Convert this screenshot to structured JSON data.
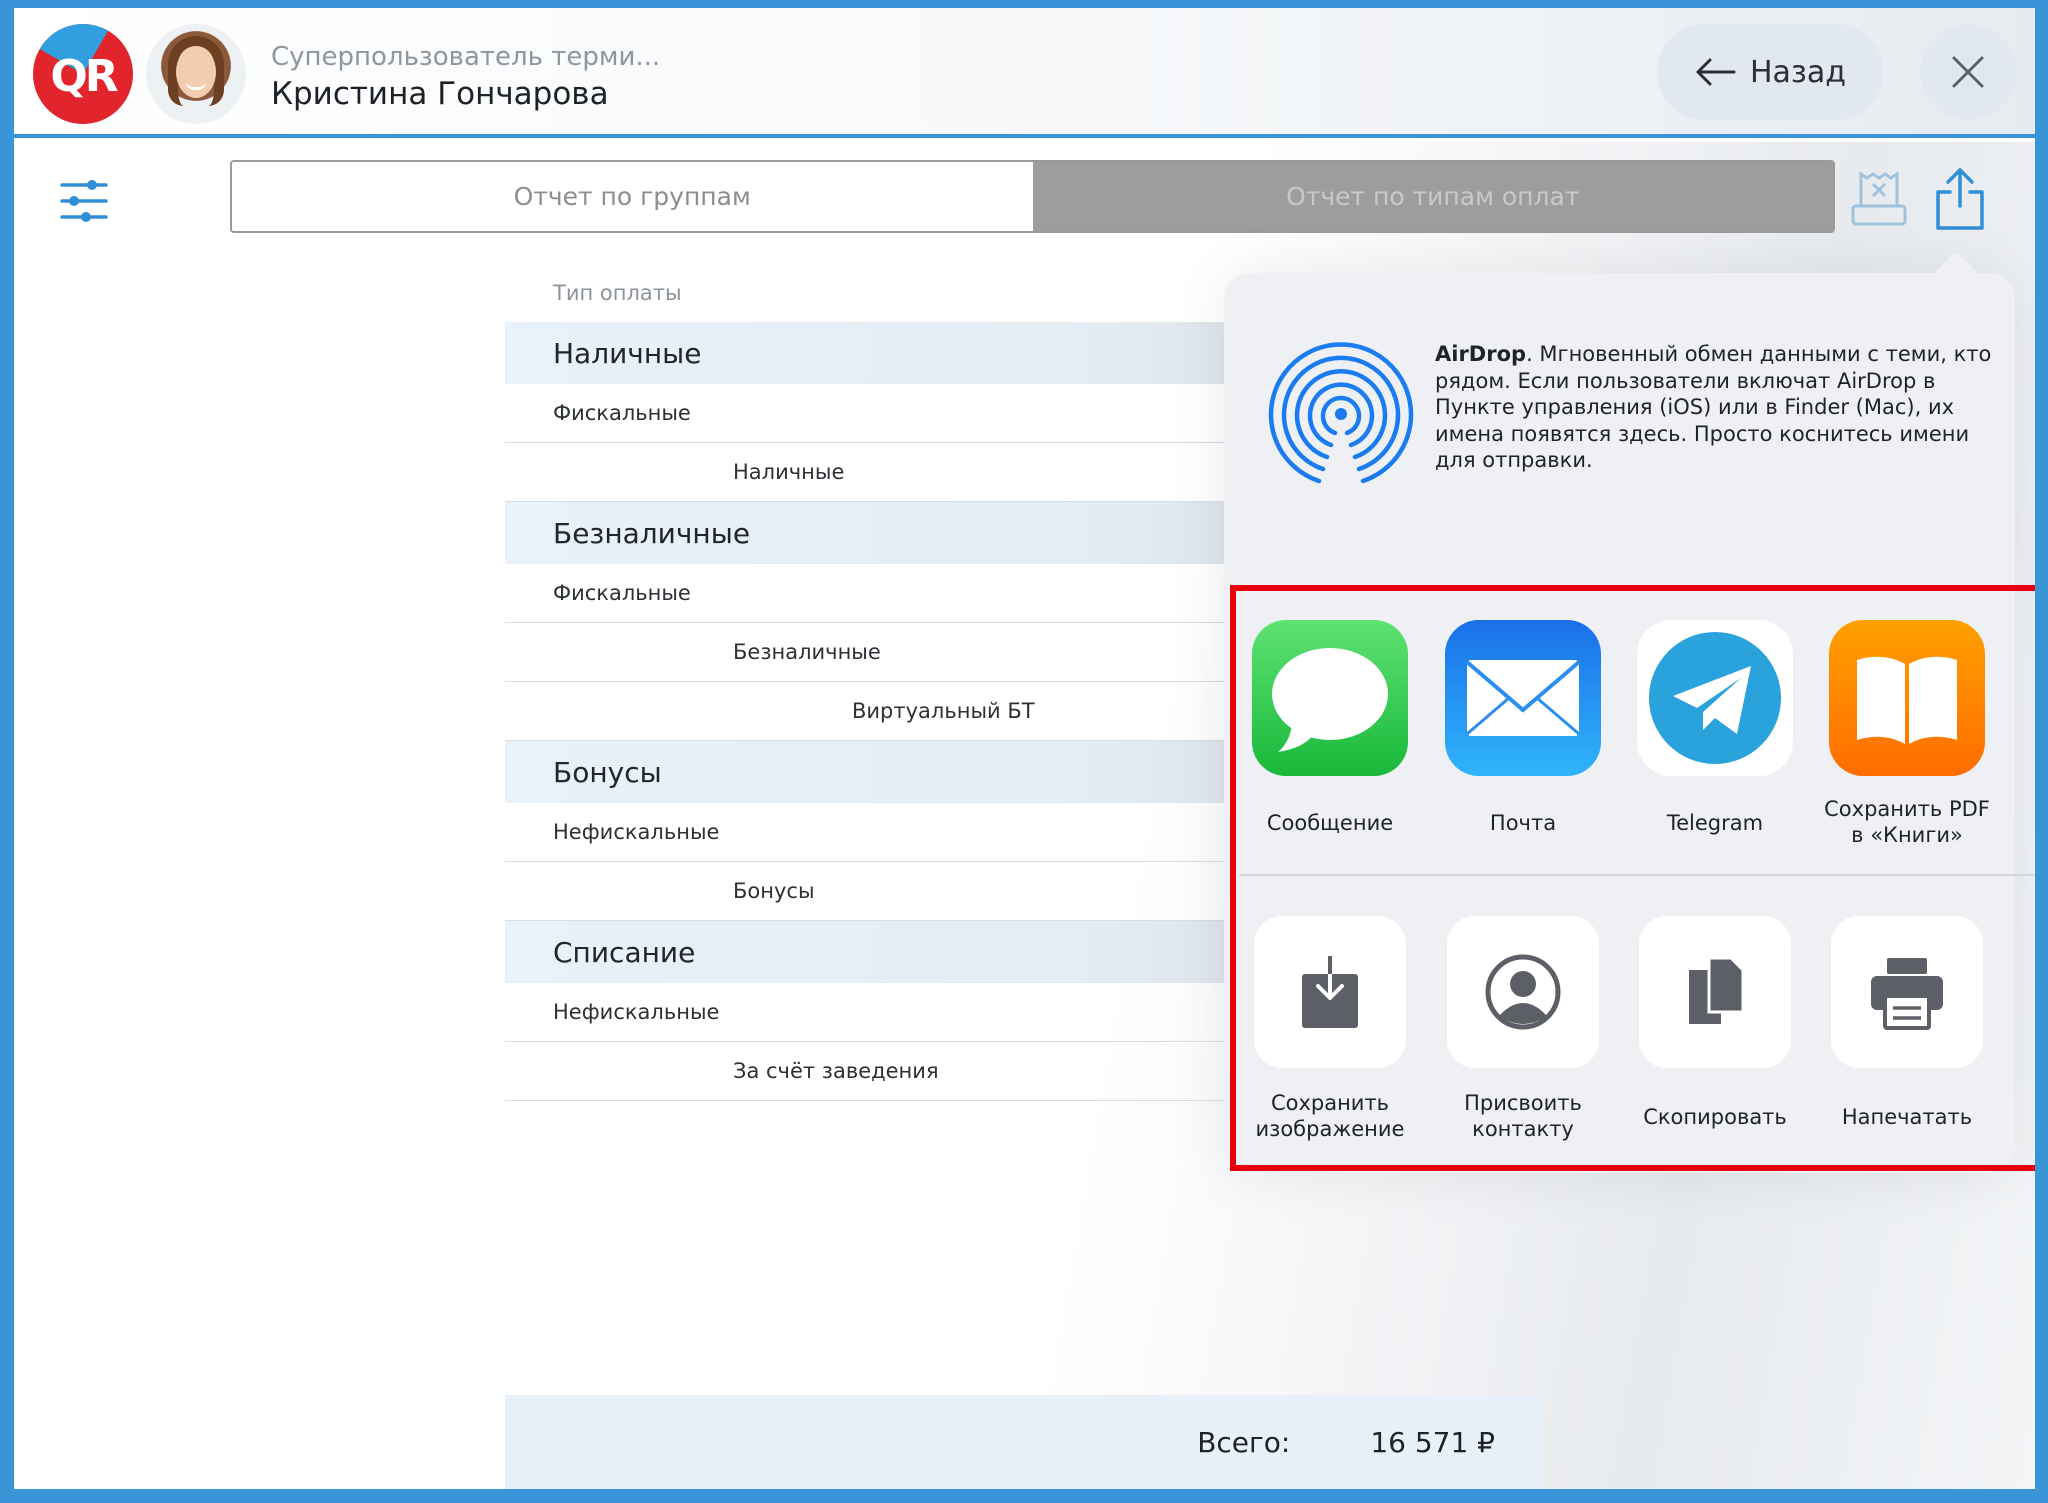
{
  "header": {
    "logo_text": "QR",
    "role": "Суперпользователь терми...",
    "user_name": "Кристина Гончарова",
    "back_label": "Назад"
  },
  "tabs": [
    {
      "label": "Отчет по группам",
      "selected": false
    },
    {
      "label": "Отчет по типам оплат",
      "selected": true
    }
  ],
  "report": {
    "column_header": "Тип оплаты",
    "rows": [
      {
        "type": "group",
        "level": 0,
        "label": "Наличные"
      },
      {
        "type": "sub",
        "level": 1,
        "label": "Фискальные"
      },
      {
        "type": "sub",
        "level": 2,
        "label": "Наличные"
      },
      {
        "type": "group",
        "level": 0,
        "label": "Безналичные"
      },
      {
        "type": "sub",
        "level": 1,
        "label": "Фискальные"
      },
      {
        "type": "sub",
        "level": 2,
        "label": "Безналичные"
      },
      {
        "type": "sub",
        "level": 3,
        "label": "Виртуальный БТ"
      },
      {
        "type": "group",
        "level": 0,
        "label": "Бонусы"
      },
      {
        "type": "sub",
        "level": 1,
        "label": "Нефискальные"
      },
      {
        "type": "sub",
        "level": 2,
        "label": "Бонусы"
      },
      {
        "type": "group",
        "level": 0,
        "label": "Списание"
      },
      {
        "type": "sub",
        "level": 1,
        "label": "Нефискальные"
      },
      {
        "type": "sub",
        "level": 2,
        "label": "За счёт заведения"
      }
    ],
    "total_label": "Всего:",
    "total_value": "16 571 ₽"
  },
  "share_sheet": {
    "airdrop_title": "AirDrop",
    "airdrop_text": ". Мгновенный обмен данными с теми, кто рядом. Если пользователи включат AirDrop в Пункте управления (iOS) или в Finder (Mac), их имена появятся здесь. Просто коснитесь имени для отправки.",
    "apps": [
      {
        "label": "Сообщение",
        "icon": "messages-icon"
      },
      {
        "label": "Почта",
        "icon": "mail-icon"
      },
      {
        "label": "Telegram",
        "icon": "telegram-icon"
      },
      {
        "label": "Сохранить PDF\nв «Книги»",
        "icon": "books-icon"
      }
    ],
    "actions": [
      {
        "label": "Сохранить\nизображение",
        "icon": "save-image-icon"
      },
      {
        "label": "Присвоить\nконтакту",
        "icon": "assign-contact-icon"
      },
      {
        "label": "Скопировать",
        "icon": "copy-icon"
      },
      {
        "label": "Напечатать",
        "icon": "print-icon"
      }
    ]
  },
  "colors": {
    "frame_blue": "#3a95d8",
    "highlight_red": "#e8000d",
    "group_row_bg": "#e9f2fb",
    "messages_green": "#34c759",
    "mail_blue": "#1e8bf0",
    "telegram_blue": "#2aa3dc",
    "books_orange": "#ff8a00"
  }
}
